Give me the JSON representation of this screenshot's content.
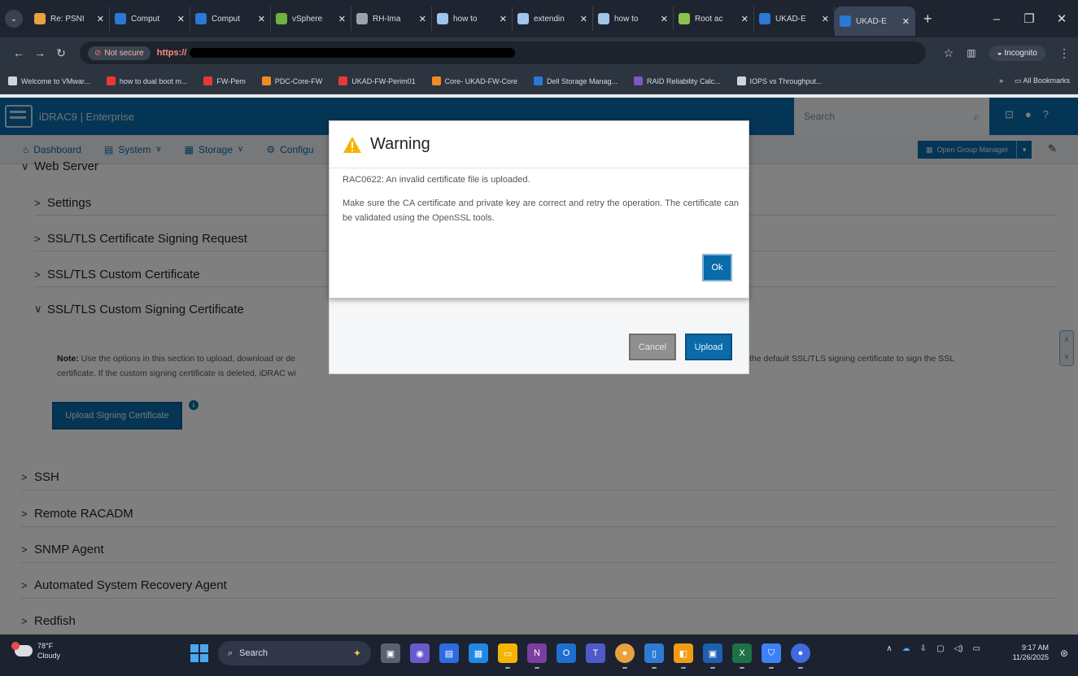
{
  "browser": {
    "tabs": [
      {
        "title": "Re: PSNI",
        "color": "#e8a33d"
      },
      {
        "title": "Comput",
        "color": "#2b78d6"
      },
      {
        "title": "Comput",
        "color": "#2b78d6"
      },
      {
        "title": "vSphere",
        "color": "#6fb23e"
      },
      {
        "title": "RH-Ima",
        "color": "#9aa3ad"
      },
      {
        "title": "how to",
        "color": "#a0c4ea"
      },
      {
        "title": "extendin",
        "color": "#a0c4ea"
      },
      {
        "title": "how to",
        "color": "#a0c4ea"
      },
      {
        "title": "Root ac",
        "color": "#8bc34a"
      },
      {
        "title": "UKAD-E",
        "color": "#2b78d6"
      },
      {
        "title": "UKAD-E",
        "color": "#2b78d6"
      }
    ],
    "active_tab_index": 10,
    "address": {
      "security_label": "Not secure",
      "url_visible": "https://"
    },
    "incognito_label": "Incognito",
    "bookmarks": [
      {
        "label": "Welcome to VMwar...",
        "color": "#cfd4da"
      },
      {
        "label": "how to dual boot m...",
        "color": "#e53935"
      },
      {
        "label": "FW-Pem",
        "color": "#e53935"
      },
      {
        "label": "PDC-Core-FW",
        "color": "#f08a24"
      },
      {
        "label": "UKAD-FW-Perim01",
        "color": "#e53935"
      },
      {
        "label": "Core- UKAD-FW-Core",
        "color": "#f08a24"
      },
      {
        "label": "Dell Storage Manag...",
        "color": "#2b78d6"
      },
      {
        "label": "RAID Reliability Calc...",
        "color": "#7e57c2"
      },
      {
        "label": "IOPS vs Throughput...",
        "color": "#cfd4da"
      }
    ],
    "all_bookmarks_label": "All Bookmarks"
  },
  "idrac": {
    "brand": "iDRAC9 | Enterprise",
    "search_placeholder": "Search",
    "nav": [
      {
        "label": "Dashboard",
        "icon": "home-icon"
      },
      {
        "label": "System",
        "icon": "server-icon"
      },
      {
        "label": "Storage",
        "icon": "storage-icon"
      },
      {
        "label": "Configu",
        "icon": "config-icon"
      }
    ],
    "group_manager_label": "Open Group Manager"
  },
  "content": {
    "section_web_server": "Web Server",
    "web_server_items": [
      "Settings",
      "SSL/TLS Certificate Signing Request",
      "SSL/TLS Custom Certificate",
      "SSL/TLS Custom Signing Certificate"
    ],
    "note_label": "Note:",
    "note_text_1": " Use the options in this section to upload, download or de",
    "note_text_2": "tead of the default SSL/TLS signing certificate to sign the SSL",
    "note_text_3": "certificate. If the custom signing certificate is deleted, iDRAC wi",
    "upload_signing_label": "Upload Signing Certificate",
    "other_sections": [
      "SSH",
      "Remote RACADM",
      "SNMP Agent",
      "Automated System Recovery Agent",
      "Redfish"
    ]
  },
  "upload_dialog": {
    "cancel_label": "Cancel",
    "upload_label": "Upload"
  },
  "warning_dialog": {
    "title": "Warning",
    "code_line": "RAC0622: An invalid certificate file is uploaded.",
    "body": "Make sure the CA certificate and private key are correct and retry the operation. The certificate can be validated using the OpenSSL tools.",
    "ok_label": "Ok"
  },
  "taskbar": {
    "weather_temp": "78°F",
    "weather_cond": "Cloudy",
    "search_label": "Search",
    "time": "9:17 AM",
    "date": "11/26/2025"
  }
}
